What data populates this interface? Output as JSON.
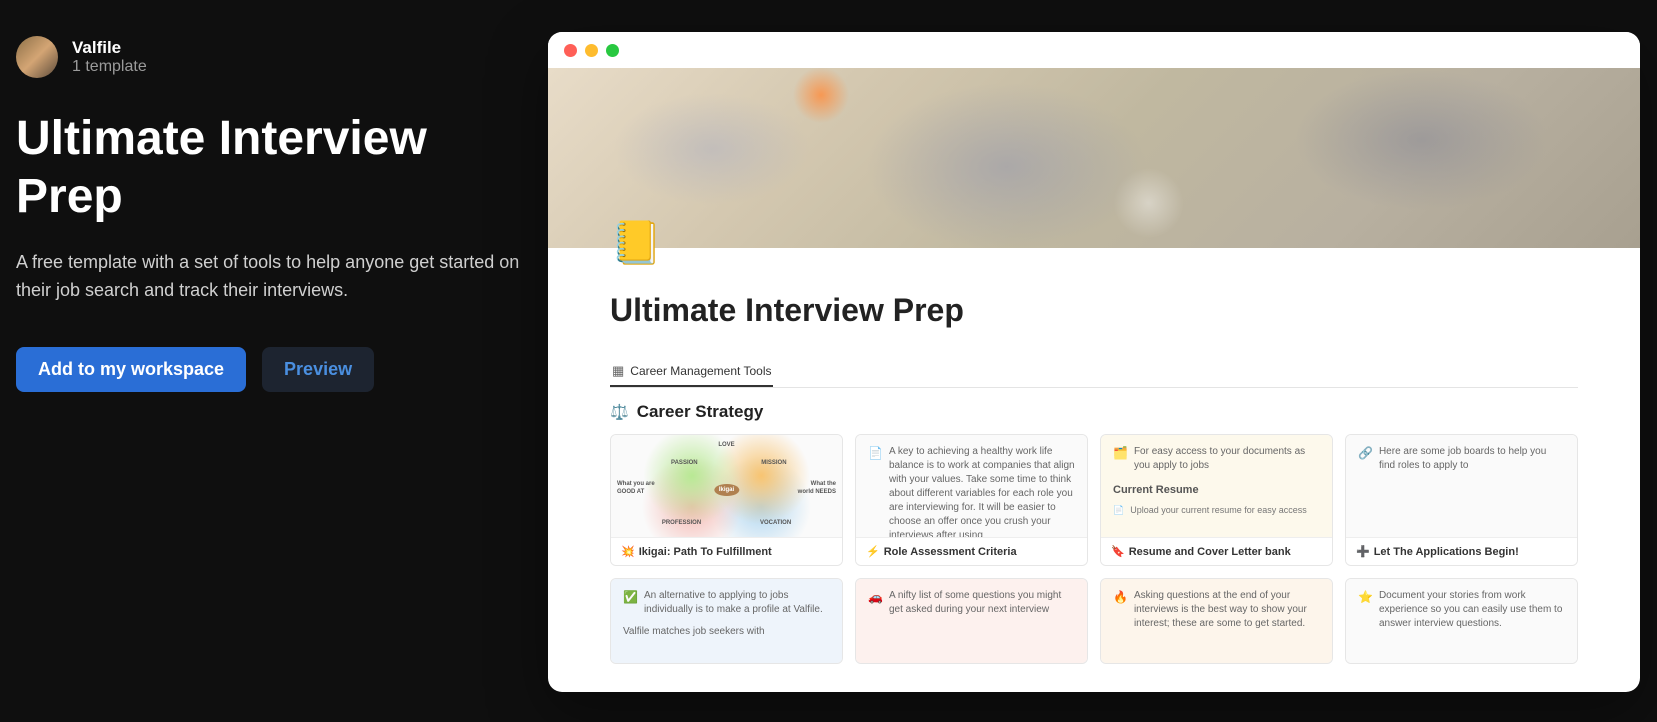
{
  "author": {
    "name": "Valfile",
    "subtitle": "1 template"
  },
  "page": {
    "title": "Ultimate Interview Prep",
    "description": "A free template with a set of tools to help anyone get started on their job search and track their interviews."
  },
  "buttons": {
    "primary": "Add to my workspace",
    "secondary": "Preview"
  },
  "doc": {
    "icon": "📒",
    "title": "Ultimate Interview Prep",
    "tab": "Career Management Tools",
    "section": {
      "icon": "⚖️",
      "title": "Career Strategy"
    },
    "cards_row1": [
      {
        "footer_icon": "💥",
        "footer": "Ikigai: Path To Fulfillment",
        "ikigai": {
          "center": "Ikigai",
          "top": "LOVE",
          "left_top": "PASSION",
          "right_top": "MISSION",
          "left": "What you are GOOD AT",
          "right": "What the world NEEDS",
          "left_bot": "PROFESSION",
          "right_bot": "VOCATION"
        }
      },
      {
        "body_icon": "📄",
        "body": "A key to achieving a healthy work life balance is to work at companies that align with your values. Take some time to think about different variables for each role you are interviewing for. It will be easier to choose an offer once you crush your interviews after using",
        "footer_icon": "⚡",
        "footer": "Role Assessment Criteria",
        "tint": "tint-plain"
      },
      {
        "body_icon": "🗂️",
        "body": "For easy access to your documents as you apply to jobs",
        "sub_section": "Current Resume",
        "upload": "Upload your current resume for easy access",
        "footer_icon": "🔖",
        "footer": "Resume and Cover Letter bank",
        "tint": "tint-yellow"
      },
      {
        "body_icon": "🔗",
        "body": "Here are some job boards to help you find roles to apply to",
        "footer_icon": "➕",
        "footer": "Let The Applications Begin!",
        "tint": "tint-plain"
      }
    ],
    "cards_row2": [
      {
        "body_icon": "✅",
        "body": "An alternative to applying to jobs individually is to make a profile at Valfile.",
        "body2": "Valfile matches job seekers with",
        "tint": "tint-blue"
      },
      {
        "body_icon": "🚗",
        "body": "A nifty list of some questions you might get asked during your next interview",
        "tint": "tint-pink"
      },
      {
        "body_icon": "🔥",
        "body": "Asking questions at the end of your interviews is the best way to show your interest; these are some to get started.",
        "tint": "tint-orange"
      },
      {
        "body_icon": "⭐",
        "body": "Document your stories from work experience so you can easily use them to answer interview questions.",
        "tint": "tint-plain"
      }
    ]
  }
}
